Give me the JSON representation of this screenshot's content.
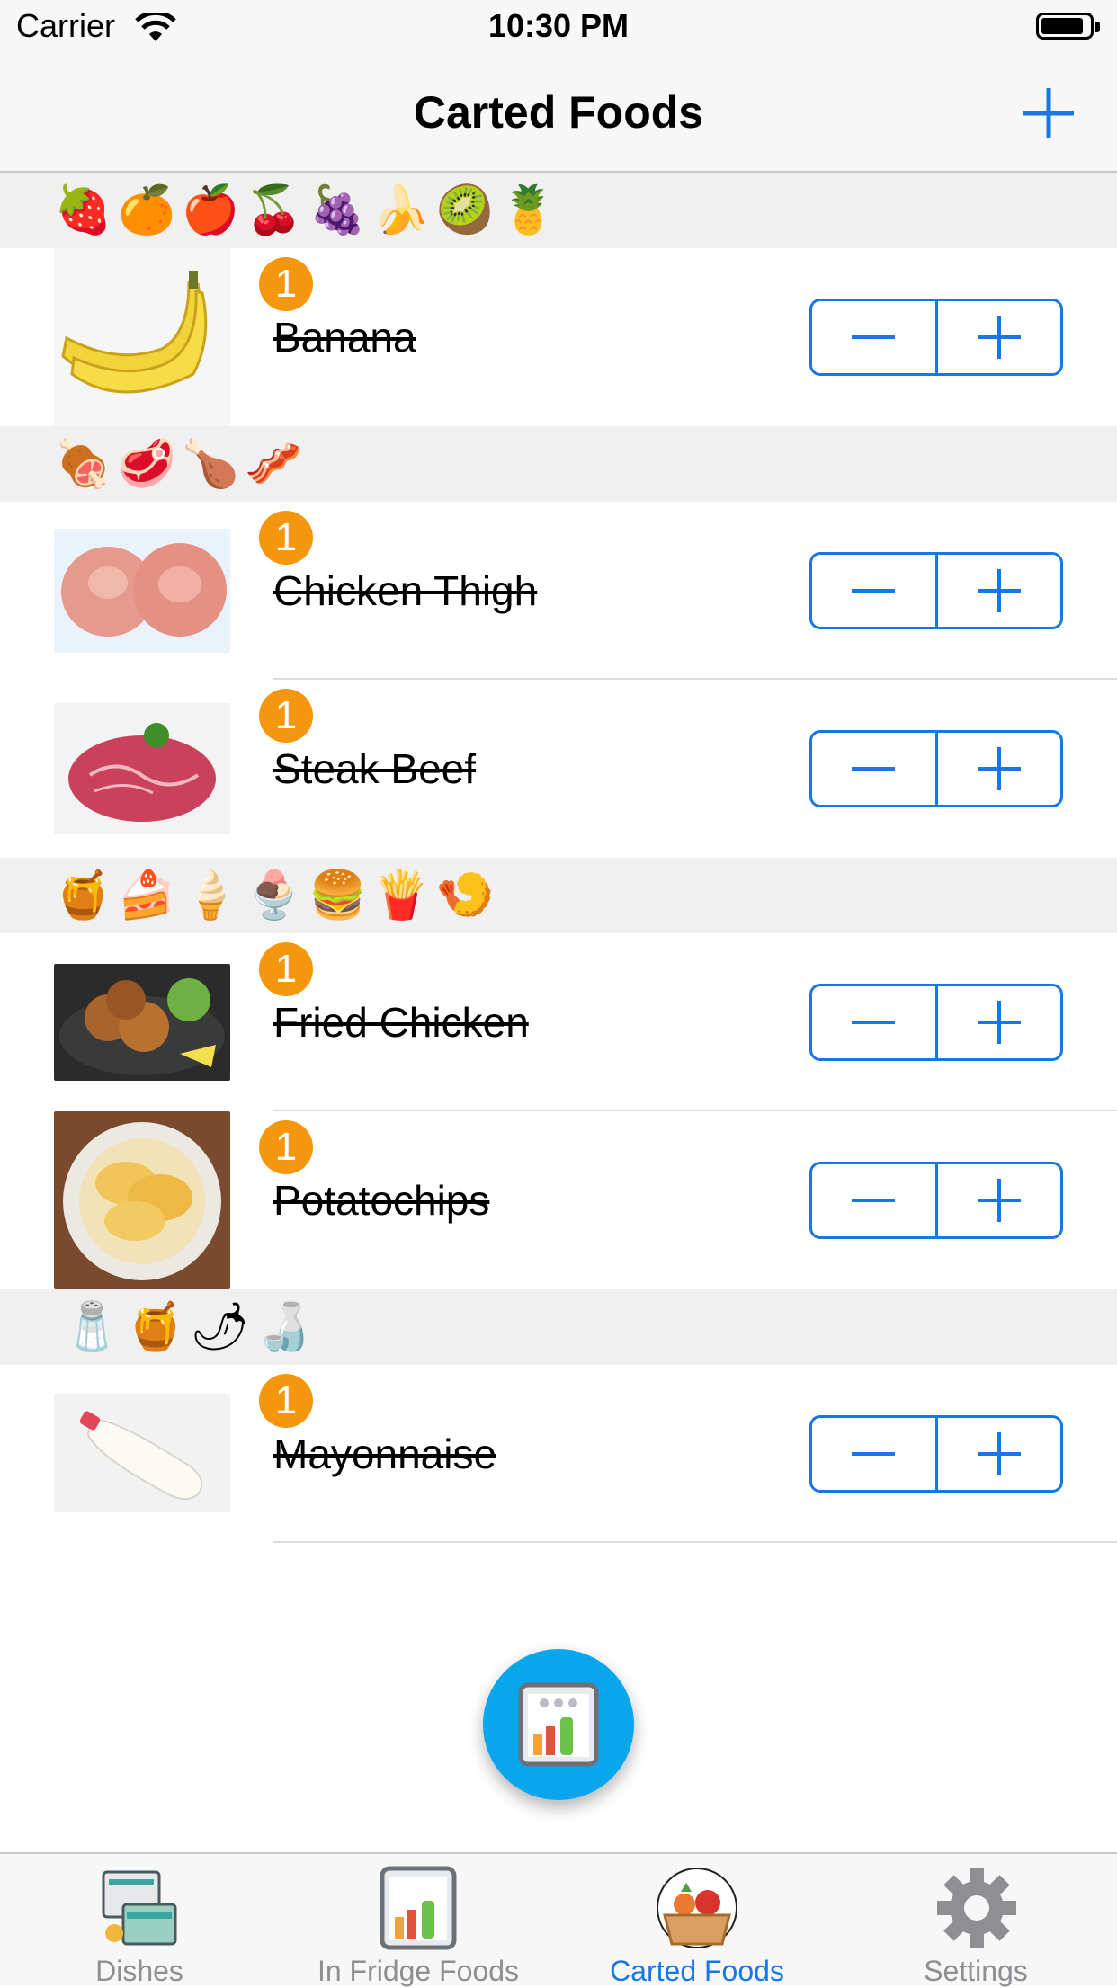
{
  "status_bar": {
    "carrier": "Carrier",
    "time": "10:30 PM"
  },
  "nav": {
    "title": "Carted Foods"
  },
  "sections": [
    {
      "emojis": "🍓🍊🍎🍒🍇🍌🥝🍍",
      "items": [
        {
          "name": "Banana",
          "count": "1",
          "image": "banana"
        }
      ]
    },
    {
      "emojis": "🍖🥩🍗🥓",
      "items": [
        {
          "name": "Chicken Thigh",
          "count": "1",
          "image": "raw-chicken"
        },
        {
          "name": "Steak Beef",
          "count": "1",
          "image": "beef"
        }
      ]
    },
    {
      "emojis": "🍯🍰🍦🍨🍔🍟🍤",
      "items": [
        {
          "name": "Fried Chicken",
          "count": "1",
          "image": "fried-chicken"
        },
        {
          "name": "Potatochips",
          "count": "1",
          "image": "chips"
        }
      ]
    },
    {
      "emojis": "🧂🍯🌶🍶",
      "items": [
        {
          "name": "Mayonnaise",
          "count": "1",
          "image": "mayo"
        }
      ]
    }
  ],
  "tabs": [
    {
      "label": "Dishes",
      "icon": "dishes-icon"
    },
    {
      "label": "In Fridge Foods",
      "icon": "fridge-icon"
    },
    {
      "label": "Carted Foods",
      "icon": "basket-icon",
      "active": true
    },
    {
      "label": "Settings",
      "icon": "gear-icon"
    }
  ],
  "colors": {
    "accent": "#1877e6",
    "badge": "#f5960f",
    "fab": "#08a6ec",
    "section_bg": "#f0f0f0",
    "inactive_tab": "#8e8e93"
  }
}
